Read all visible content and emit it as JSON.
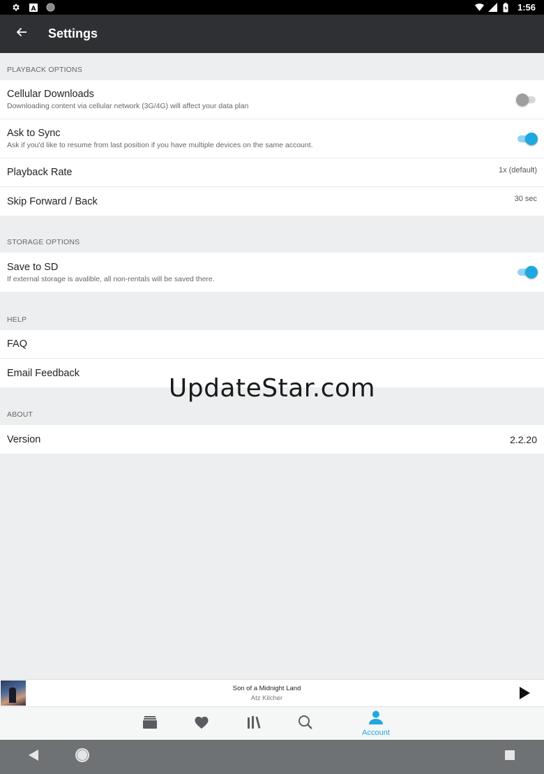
{
  "status_bar": {
    "time": "1:56",
    "left_icons": [
      "gear-icon",
      "a-icon",
      "circle-icon"
    ],
    "right_icons": [
      "wifi-icon",
      "cell-signal-icon",
      "battery-icon"
    ]
  },
  "app_bar": {
    "title": "Settings",
    "back_icon": "arrow-left-icon"
  },
  "sections": {
    "playback": {
      "header": "PLAYBACK OPTIONS",
      "cellular": {
        "title": "Cellular Downloads",
        "subtitle": "Downloading content via cellular network (3G/4G) will affect your data plan",
        "enabled": false
      },
      "sync": {
        "title": "Ask to Sync",
        "subtitle": "Ask if you'd like to resume from last position if you have multiple devices on the same account.",
        "enabled": true
      },
      "rate": {
        "title": "Playback Rate",
        "value": "1x (default)"
      },
      "skip": {
        "title": "Skip Forward / Back",
        "value": "30 sec"
      }
    },
    "storage": {
      "header": "STORAGE OPTIONS",
      "sd": {
        "title": "Save to SD",
        "subtitle": "If external storage is avalible, all non-rentals will be saved there.",
        "enabled": true
      }
    },
    "help": {
      "header": "HELP",
      "faq": "FAQ",
      "feedback": "Email Feedback"
    },
    "about": {
      "header": "ABOUT",
      "version_label": "Version",
      "version_value": "2.2.20"
    }
  },
  "watermark": "UpdateStar.com",
  "now_playing": {
    "title": "Son of a Midnight Land",
    "artist": "Atz Kilcher",
    "play_icon": "play-icon"
  },
  "tab_bar": {
    "tabs": [
      {
        "icon": "store-icon",
        "label": ""
      },
      {
        "icon": "heart-icon",
        "label": ""
      },
      {
        "icon": "library-icon",
        "label": ""
      },
      {
        "icon": "search-icon",
        "label": ""
      },
      {
        "icon": "person-icon",
        "label": "Account",
        "active": true
      }
    ],
    "active_color": "#1fa8e0"
  },
  "nav_bar": {
    "buttons": [
      "back-triangle-icon",
      "home-circle-icon",
      "recents-square-icon"
    ]
  },
  "colors": {
    "app_bar": "#2e3033",
    "accent": "#1fa8e0",
    "background": "#eceeef"
  }
}
